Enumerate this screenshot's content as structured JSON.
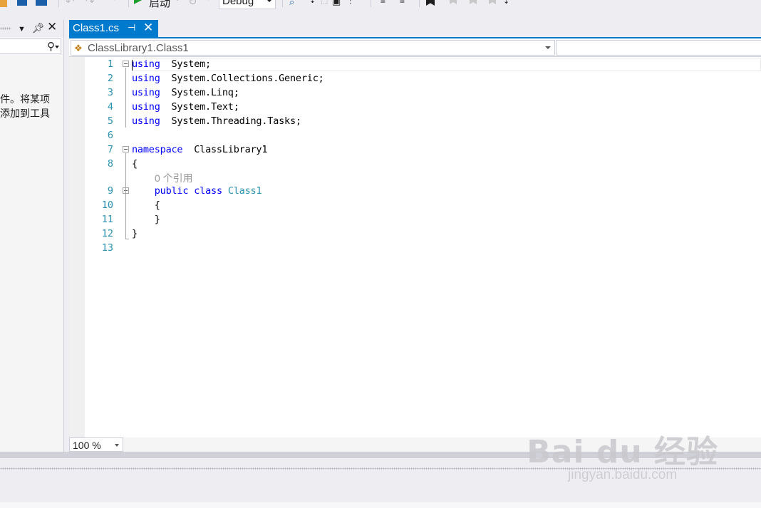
{
  "toolbar": {
    "start_label": "启动",
    "config_value": "Debug"
  },
  "left_panel": {
    "hint_line1": "件。将某项",
    "hint_line2": "添加到工具"
  },
  "tab": {
    "title": "Class1.cs"
  },
  "navbar": {
    "type_selector": "ClassLibrary1.Class1",
    "member_selector": ""
  },
  "editor": {
    "lines": [
      {
        "n": "1",
        "parts": [
          [
            "kw",
            "using"
          ],
          [
            "",
            "  System;"
          ]
        ]
      },
      {
        "n": "2",
        "parts": [
          [
            "kw",
            "using"
          ],
          [
            "",
            "  System.Collections.Generic;"
          ]
        ]
      },
      {
        "n": "3",
        "parts": [
          [
            "kw",
            "using"
          ],
          [
            "",
            "  System.Linq;"
          ]
        ]
      },
      {
        "n": "4",
        "parts": [
          [
            "kw",
            "using"
          ],
          [
            "",
            "  System.Text;"
          ]
        ]
      },
      {
        "n": "5",
        "parts": [
          [
            "kw",
            "using"
          ],
          [
            "",
            "  System.Threading.Tasks;"
          ]
        ]
      },
      {
        "n": "6",
        "parts": []
      },
      {
        "n": "7",
        "parts": [
          [
            "kw",
            "namespace"
          ],
          [
            "",
            "  ClassLibrary1"
          ]
        ]
      },
      {
        "n": "8",
        "parts": [
          [
            "",
            "{"
          ]
        ]
      },
      {
        "n": "9",
        "parts": [
          [
            "",
            "    "
          ],
          [
            "kw",
            "public"
          ],
          [
            "",
            " "
          ],
          [
            "kw",
            "class"
          ],
          [
            "",
            " "
          ],
          [
            "type",
            "Class1"
          ]
        ]
      },
      {
        "n": "10",
        "parts": [
          [
            "",
            "    {"
          ]
        ]
      },
      {
        "n": "11",
        "parts": [
          [
            "",
            "    }"
          ]
        ]
      },
      {
        "n": "12",
        "parts": [
          [
            "",
            "}"
          ]
        ]
      },
      {
        "n": "13",
        "parts": []
      }
    ],
    "codelens": "0 个引用"
  },
  "zoom": {
    "value": "100 %"
  },
  "watermark": {
    "logo": "Bai du 经验",
    "url": "jingyan.baidu.com"
  },
  "icons": [
    "save-icon",
    "undo-icon",
    "redo-icon",
    "play-icon",
    "refresh-icon",
    "find-icon",
    "bookmark-icon",
    "pin-icon",
    "close-icon",
    "search-icon",
    "class-icon",
    "chevron-down-icon"
  ],
  "colors": {
    "accent": "#007acc",
    "keyword": "#0000ff",
    "type": "#2b91af",
    "line_number": "#2b91af",
    "codelens": "#999999"
  }
}
